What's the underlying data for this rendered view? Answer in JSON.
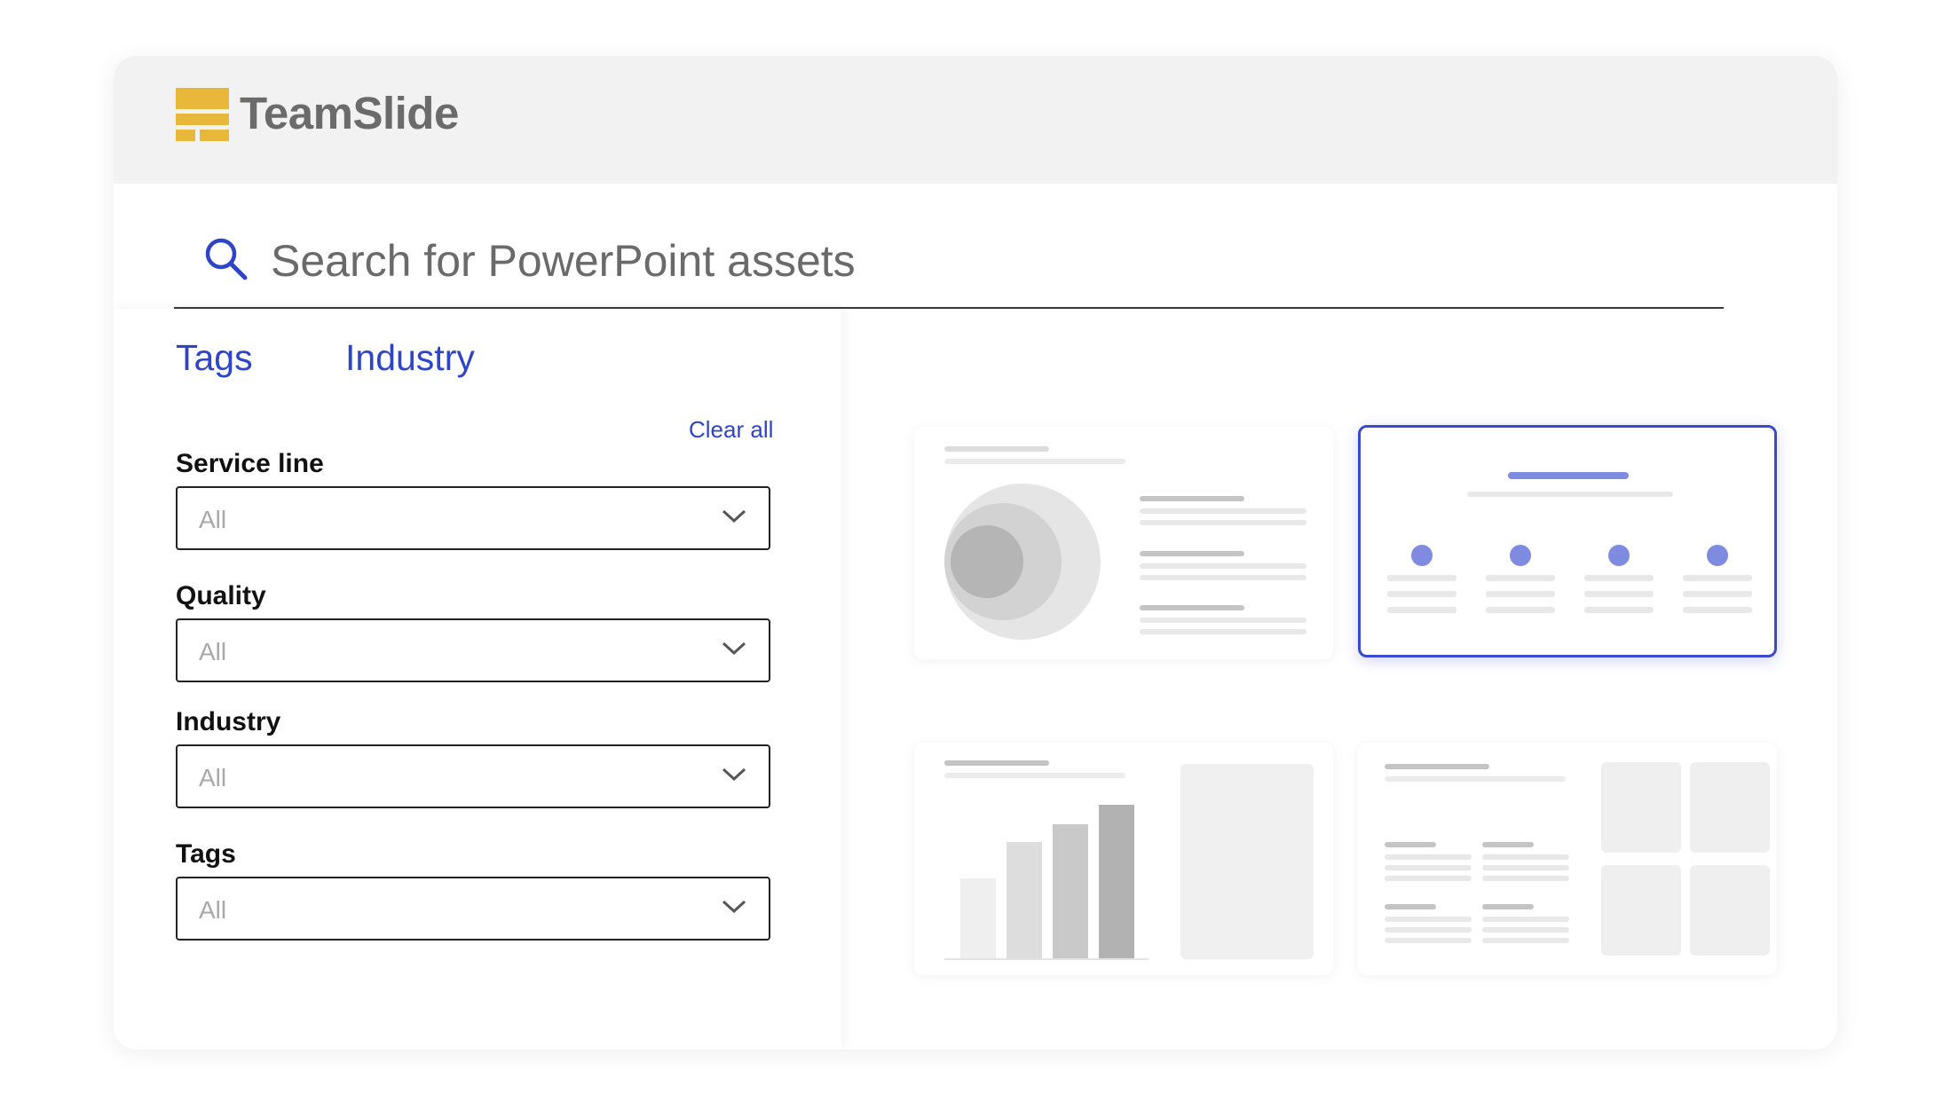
{
  "app": {
    "brand": "TeamSlide",
    "logo_icon": "teamslide-logo-icon",
    "accent_color": "#2f45c8",
    "logo_color": "#e8b83a"
  },
  "search": {
    "icon": "search-icon",
    "placeholder": "Search for PowerPoint assets"
  },
  "filters": {
    "tabs": [
      {
        "label": "Tags"
      },
      {
        "label": "Industry"
      }
    ],
    "clear_all_label": "Clear all",
    "fields": [
      {
        "label": "Service line",
        "value": "All"
      },
      {
        "label": "Quality",
        "value": "All"
      },
      {
        "label": "Industry",
        "value": "All"
      },
      {
        "label": "Tags",
        "value": "All"
      }
    ]
  },
  "results": {
    "cards": [
      {
        "kind": "circle-diagram-slide",
        "selected": false
      },
      {
        "kind": "four-steps-slide",
        "selected": true
      },
      {
        "kind": "bar-chart-slide",
        "selected": false
      },
      {
        "kind": "grid-layout-slide",
        "selected": false
      }
    ]
  }
}
